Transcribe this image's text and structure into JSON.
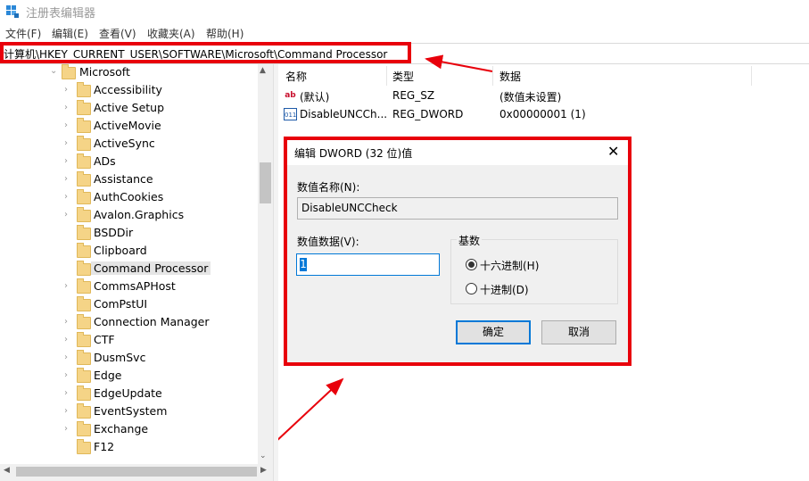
{
  "window": {
    "title": "注册表编辑器"
  },
  "menu": [
    "文件(F)",
    "编辑(E)",
    "查看(V)",
    "收藏夹(A)",
    "帮助(H)"
  ],
  "address": {
    "path": "计算机\\HKEY_CURRENT_USER\\SOFTWARE\\Microsoft\\Command Processor"
  },
  "tree": {
    "parent": "Microsoft",
    "items": [
      "Accessibility",
      "Active Setup",
      "ActiveMovie",
      "ActiveSync",
      "ADs",
      "Assistance",
      "AuthCookies",
      "Avalon.Graphics",
      "BSDDir",
      "Clipboard",
      "Command Processor",
      "CommsAPHost",
      "ComPstUI",
      "Connection Manager",
      "CTF",
      "DusmSvc",
      "Edge",
      "EdgeUpdate",
      "EventSystem",
      "Exchange",
      "F12"
    ],
    "selected": "Command Processor"
  },
  "list": {
    "headers": {
      "name": "名称",
      "type": "类型",
      "data": "数据"
    },
    "rows": [
      {
        "icon": "ab",
        "name": "(默认)",
        "type": "REG_SZ",
        "data": "(数值未设置)"
      },
      {
        "icon": "011",
        "name": "DisableUNCCh...",
        "type": "REG_DWORD",
        "data": "0x00000001 (1)"
      }
    ]
  },
  "dialog": {
    "title": "编辑 DWORD (32 位)值",
    "close": "✕",
    "name_label": "数值名称(N):",
    "name_value": "DisableUNCCheck",
    "data_label": "数值数据(V):",
    "data_value": "1",
    "base_label": "基数",
    "hex_option": "十六进制(H)",
    "dec_option": "十进制(D)",
    "base_selected": "hex",
    "ok": "确定",
    "cancel": "取消"
  },
  "colors": {
    "highlight": "#e8000b",
    "accent": "#0078d7",
    "folder": "#f5d487"
  }
}
